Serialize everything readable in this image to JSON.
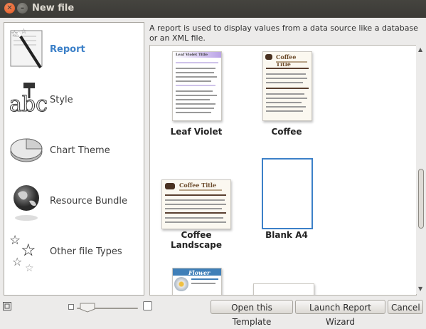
{
  "window": {
    "title": "New file"
  },
  "categories": [
    {
      "label": "Report",
      "icon": "report-wand-icon",
      "selected": true
    },
    {
      "label": "Style",
      "icon": "style-font-icon",
      "selected": false
    },
    {
      "label": "Chart Theme",
      "icon": "pie-chart-icon",
      "selected": false
    },
    {
      "label": "Resource Bundle",
      "icon": "globe-icon",
      "selected": false
    },
    {
      "label": "Other file Types",
      "icon": "stars-icon",
      "selected": false
    }
  ],
  "description": "A report is used to display values from a data source like a database or an XML file.",
  "templates": [
    {
      "label": "Leaf Violet",
      "preview_title": "Leaf Violet Title"
    },
    {
      "label": "Coffee",
      "preview_title": "Coffee Title"
    },
    {
      "label": "Coffee Landscape",
      "preview_title": "Coffee Title"
    },
    {
      "label": "Blank A4",
      "selected": true
    },
    {
      "label": "",
      "preview_title": "Flower Title"
    },
    {
      "label": ""
    }
  ],
  "buttons": {
    "open_template": "Open this Template",
    "launch_wizard": "Launch Report Wizard",
    "cancel": "Cancel"
  },
  "colors": {
    "selection": "#3c80c8",
    "titlebar": "#3c3b37"
  }
}
